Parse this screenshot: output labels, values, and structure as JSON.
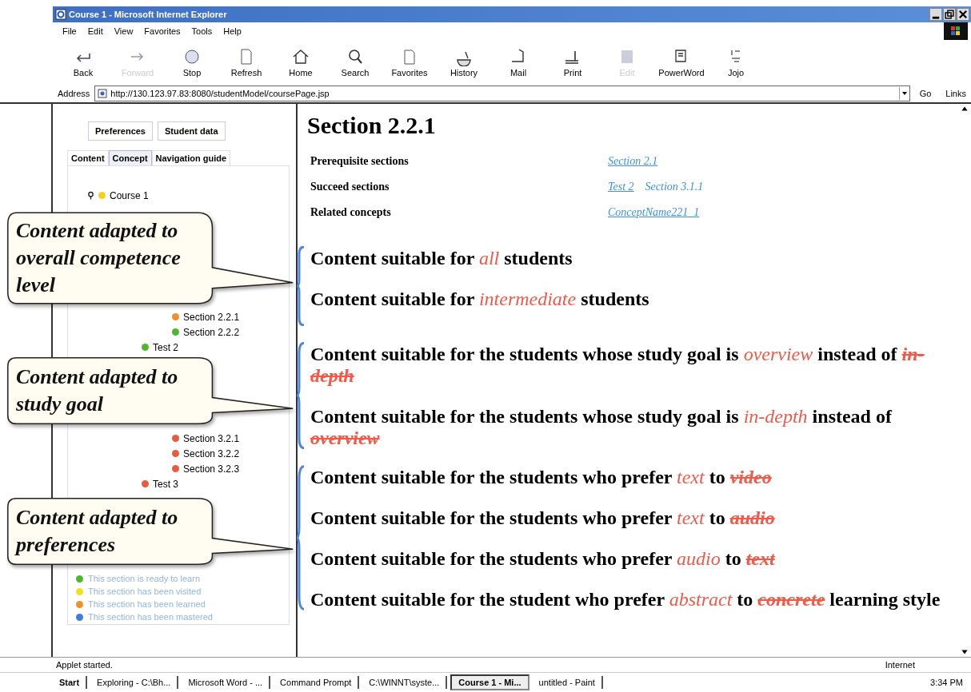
{
  "window": {
    "title": "Course 1 - Microsoft Internet Explorer"
  },
  "menu": [
    "File",
    "Edit",
    "View",
    "Favorites",
    "Tools",
    "Help"
  ],
  "toolbar": [
    {
      "label": "Back",
      "disabled": false
    },
    {
      "label": "Forward",
      "disabled": true
    },
    {
      "label": "Stop",
      "disabled": false
    },
    {
      "label": "Refresh",
      "disabled": false
    },
    {
      "label": "Home",
      "disabled": false
    },
    {
      "label": "Search",
      "disabled": false
    },
    {
      "label": "Favorites",
      "disabled": false
    },
    {
      "label": "History",
      "disabled": false
    },
    {
      "label": "Mail",
      "disabled": false
    },
    {
      "label": "Print",
      "disabled": false
    },
    {
      "label": "Edit",
      "disabled": true
    },
    {
      "label": "PowerWord",
      "disabled": false
    },
    {
      "label": "Jojo",
      "disabled": false
    }
  ],
  "address": {
    "label": "Address",
    "value": "http://130.123.97.83:8080/studentModel/coursePage.jsp",
    "go": "Go",
    "links": "Links"
  },
  "sidebar": {
    "buttons": [
      "Preferences",
      "Student data"
    ],
    "tabs": [
      {
        "label": "Content",
        "selected": false
      },
      {
        "label": "Concept",
        "selected": true
      },
      {
        "label": "Navigation guide",
        "selected": false
      }
    ],
    "tree": [
      {
        "label": "Course 1",
        "color": "#f2d31c",
        "children": [
          {
            "children": [
              {
                "label": "Section 2.2.1",
                "color": "#f0902a"
              },
              {
                "label": "Section 2.2.2",
                "color": "#4cb82e"
              }
            ]
          },
          {
            "label": "Test 2",
            "color": "#4cb82e"
          },
          {
            "children": [
              {
                "label": "Section 3.2.1",
                "color": "#ea5a3c"
              },
              {
                "label": "Section 3.2.2",
                "color": "#ea5a3c"
              },
              {
                "label": "Section 3.2.3",
                "color": "#ea5a3c"
              }
            ]
          },
          {
            "label": "Test 3",
            "color": "#ea5a3c"
          }
        ]
      }
    ],
    "legend": [
      {
        "label": "This section is ready to learn",
        "color": "#4cb82e"
      },
      {
        "label": "This section has been visited",
        "color": "#f2e21c"
      },
      {
        "label": "This section has been learned",
        "color": "#f0902a"
      },
      {
        "label": "This section has been mastered",
        "color": "#3c7ee0"
      }
    ]
  },
  "page": {
    "title": "Section 2.2.1",
    "info": [
      {
        "label": "Prerequisite sections",
        "links": [
          "Section 2.1"
        ]
      },
      {
        "label": "Succeed sections",
        "links": [
          "Test 2",
          "Section 3.1.1"
        ]
      },
      {
        "label": "Related concepts",
        "links": [
          "ConceptName221_1"
        ]
      }
    ],
    "groups": [
      {
        "callout": "Content adapted to overall competence level",
        "lines": [
          [
            {
              "kind": "plain",
              "text": "Content suitable for "
            },
            {
              "kind": "emphasis",
              "text": "all"
            },
            {
              "kind": "plain",
              "text": " students"
            }
          ],
          [
            {
              "kind": "plain",
              "text": "Content suitable for "
            },
            {
              "kind": "emphasis",
              "text": "intermediate"
            },
            {
              "kind": "plain",
              "text": " students"
            }
          ]
        ]
      },
      {
        "callout": "Content adapted to study goal",
        "lines": [
          [
            {
              "kind": "plain",
              "text": "Content suitable for the students whose study goal is "
            },
            {
              "kind": "emphasis",
              "text": "overview"
            },
            {
              "kind": "plain",
              "text": " instead of "
            },
            {
              "kind": "struck",
              "text": "in-depth"
            }
          ],
          [
            {
              "kind": "plain",
              "text": "Content suitable for the students whose study goal is "
            },
            {
              "kind": "emphasis",
              "text": "in-depth"
            },
            {
              "kind": "plain",
              "text": " instead of "
            },
            {
              "kind": "struck",
              "text": "overview"
            }
          ]
        ]
      },
      {
        "callout": "Content adapted to preferences",
        "lines": [
          [
            {
              "kind": "plain",
              "text": "Content suitable for the students who prefer "
            },
            {
              "kind": "emphasis",
              "text": "text"
            },
            {
              "kind": "plain",
              "text": " to "
            },
            {
              "kind": "struck",
              "text": "video"
            }
          ],
          [
            {
              "kind": "plain",
              "text": "Content suitable for the students who prefer "
            },
            {
              "kind": "emphasis",
              "text": "text"
            },
            {
              "kind": "plain",
              "text": " to "
            },
            {
              "kind": "struck",
              "text": "audio"
            }
          ],
          [
            {
              "kind": "plain",
              "text": "Content suitable for the students who prefer "
            },
            {
              "kind": "emphasis",
              "text": "audio"
            },
            {
              "kind": "plain",
              "text": " to "
            },
            {
              "kind": "struck",
              "text": "text"
            }
          ],
          [
            {
              "kind": "plain",
              "text": "Content suitable for the student who prefer "
            },
            {
              "kind": "emphasis",
              "text": "abstract"
            },
            {
              "kind": "plain",
              "text": " to "
            },
            {
              "kind": "struck",
              "text": "concrete"
            },
            {
              "kind": "plain",
              "text": " learning style"
            }
          ]
        ]
      }
    ]
  },
  "status_bar": {
    "text": "Applet started.",
    "zone": "Internet"
  },
  "taskbar": {
    "start": "Start",
    "items": [
      {
        "label": "Exploring - C:\\Bh...",
        "selected": false
      },
      {
        "label": "Microsoft Word - ...",
        "selected": false
      },
      {
        "label": "Command Prompt",
        "selected": false
      },
      {
        "label": "C:\\WINNT\\syste...",
        "selected": false
      },
      {
        "label": "Course 1 - Mi...",
        "selected": true
      },
      {
        "label": "untitled - Paint",
        "selected": false
      }
    ],
    "clock": "3:34 PM"
  }
}
